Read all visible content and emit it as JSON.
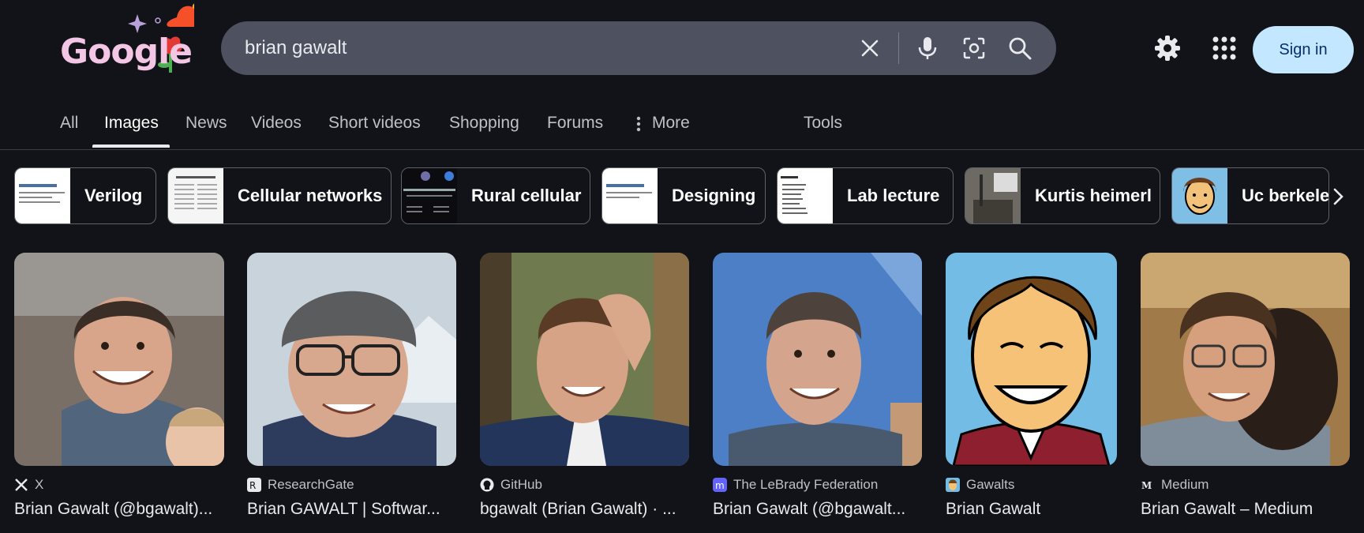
{
  "logo": {
    "text": "Google"
  },
  "search": {
    "query": "brian gawalt"
  },
  "header": {
    "signin_label": "Sign in"
  },
  "tabs": [
    {
      "label": "All",
      "active": false
    },
    {
      "label": "Images",
      "active": true
    },
    {
      "label": "News",
      "active": false
    },
    {
      "label": "Videos",
      "active": false
    },
    {
      "label": "Short videos",
      "active": false
    },
    {
      "label": "Shopping",
      "active": false
    },
    {
      "label": "Forums",
      "active": false
    },
    {
      "label": "More",
      "active": false
    },
    {
      "label": "Tools",
      "active": false
    }
  ],
  "chips": [
    {
      "label": "Verilog"
    },
    {
      "label": "Cellular networks"
    },
    {
      "label": "Rural cellular"
    },
    {
      "label": "Designing"
    },
    {
      "label": "Lab lecture"
    },
    {
      "label": "Kurtis heimerl"
    },
    {
      "label": "Uc berkele"
    }
  ],
  "results": [
    {
      "source": "X",
      "title": "Brian Gawalt (@bgawalt)..."
    },
    {
      "source": "ResearchGate",
      "title": "Brian GAWALT | Softwar..."
    },
    {
      "source": "GitHub",
      "title": "bgawalt (Brian Gawalt) · ..."
    },
    {
      "source": "The LeBrady Federation",
      "title": "Brian Gawalt (@bgawalt..."
    },
    {
      "source": "Gawalts",
      "title": "Brian Gawalt"
    },
    {
      "source": "Medium",
      "title": "Brian Gawalt – Medium"
    }
  ],
  "colors": {
    "background": "#121318",
    "search_bg": "#4d5160",
    "signin_bg": "#c2e7ff",
    "signin_text": "#062e6f"
  },
  "icons": [
    "clear-icon",
    "mic-icon",
    "lens-icon",
    "search-icon",
    "settings-icon",
    "apps-icon",
    "more-icon",
    "chevron-right-icon"
  ]
}
